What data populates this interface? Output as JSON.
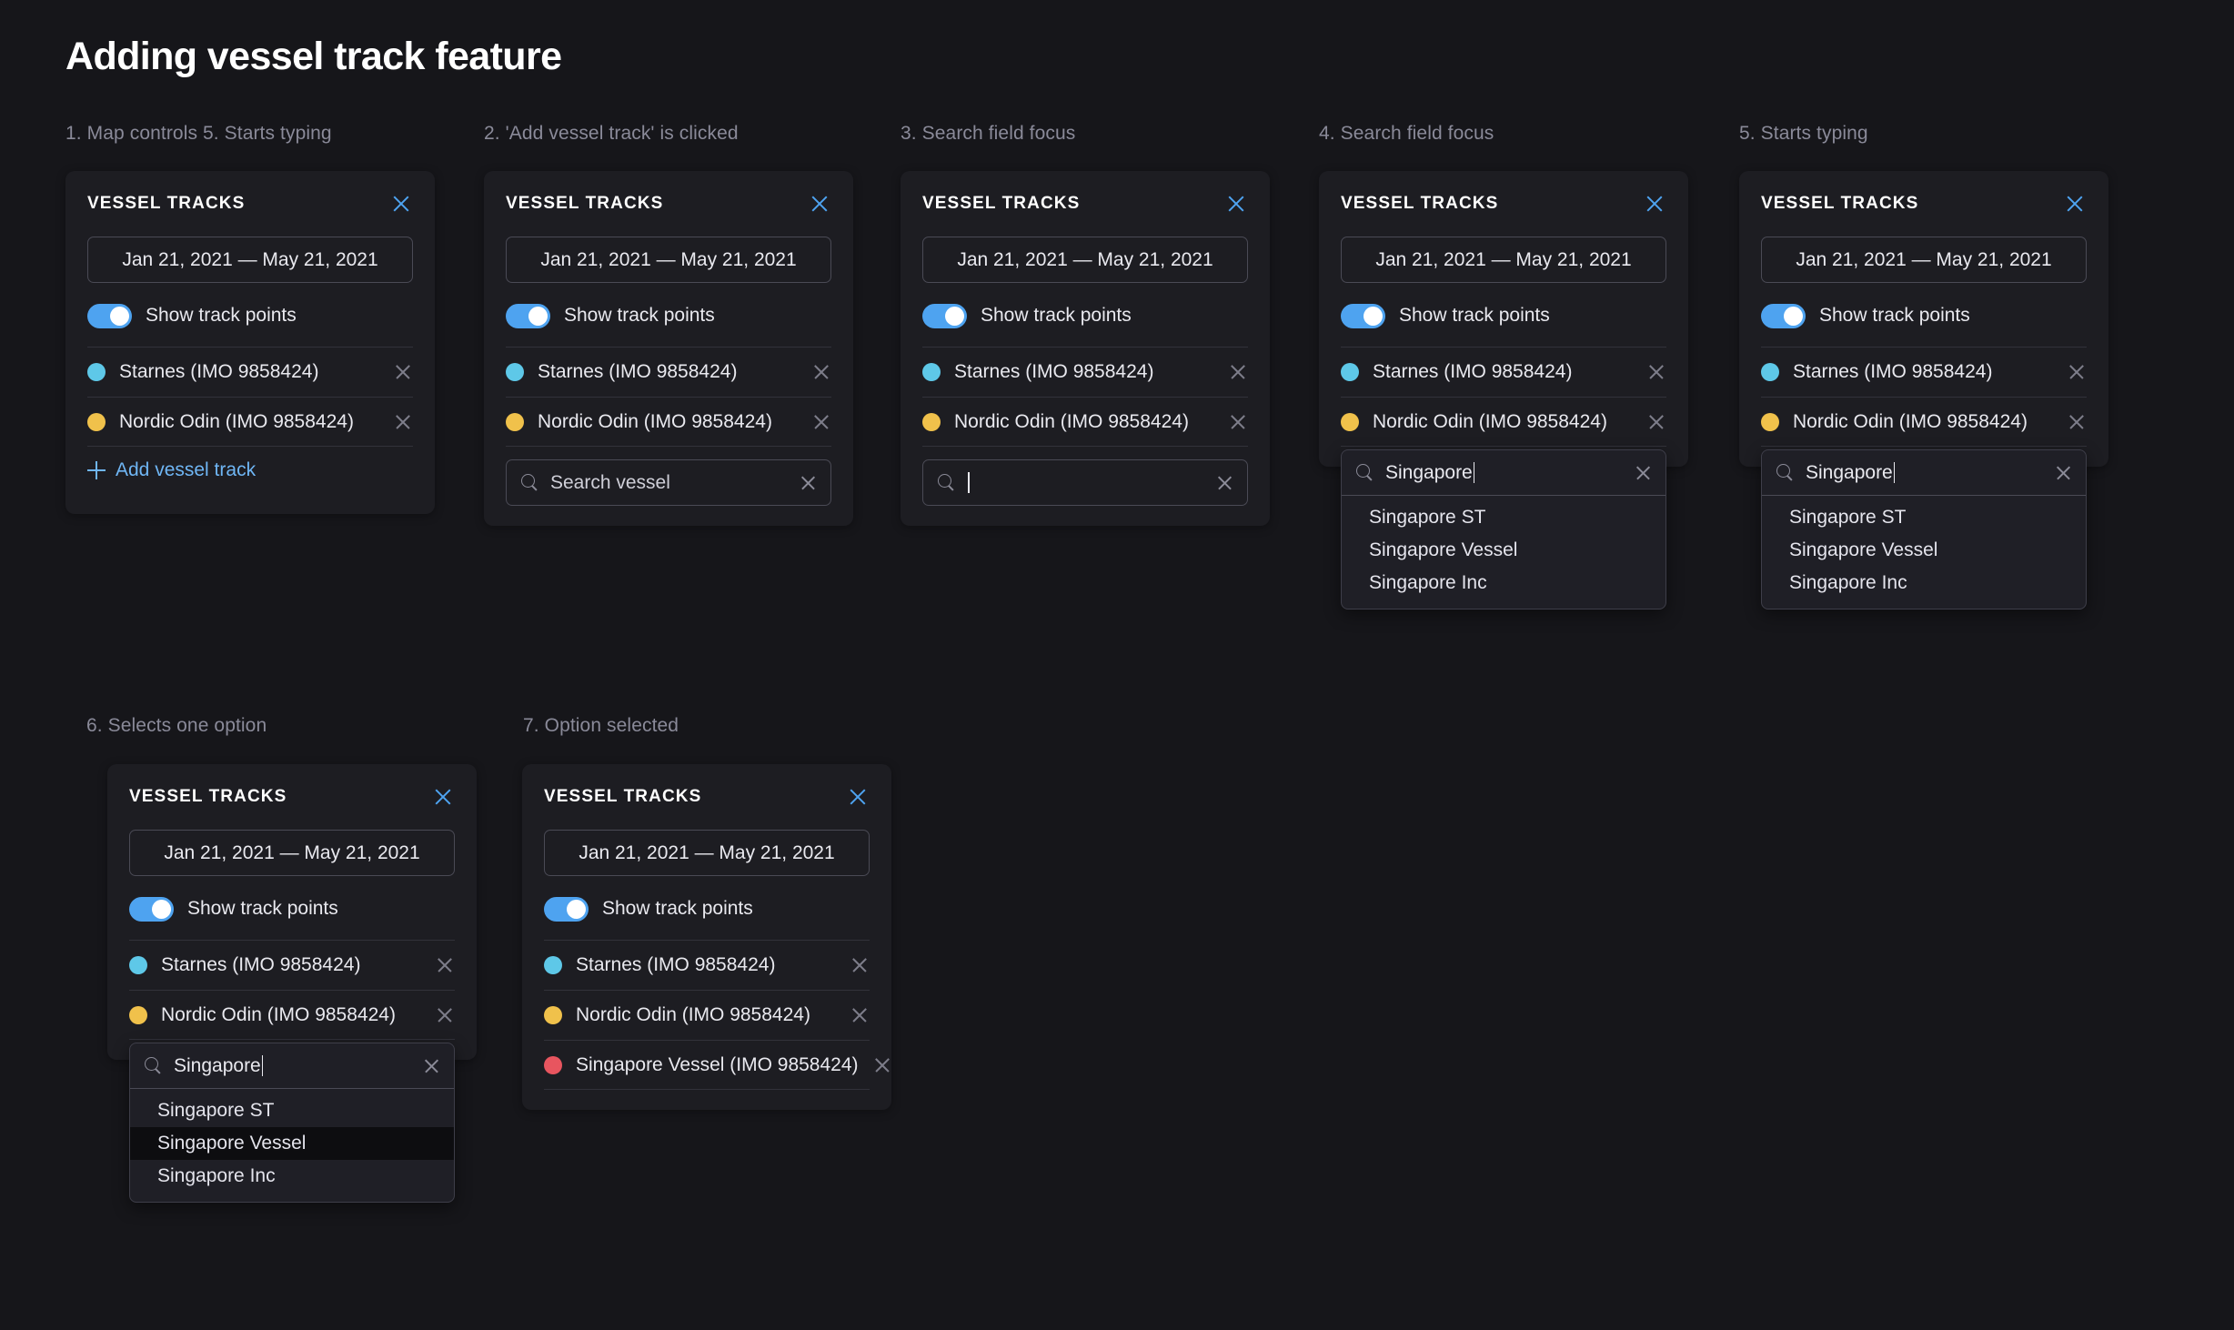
{
  "title": "Adding vessel track feature",
  "common": {
    "card_title": "VESSEL TRACKS",
    "date_range": "Jan 21, 2021 — May 21, 2021",
    "toggle_label": "Show track points",
    "add_link": "Add vessel track",
    "search_placeholder": "Search vessel",
    "search_query": "Singapore",
    "vessels": {
      "starnes": {
        "name": "Starnes (IMO 9858424)",
        "color": "#5ec8e8"
      },
      "nordic": {
        "name": "Nordic Odin (IMO 9858424)",
        "color": "#f0c14b"
      },
      "singapore": {
        "name": "Singapore Vessel (IMO 9858424)",
        "color": "#e8555f"
      }
    },
    "suggestions": [
      "Singapore ST",
      "Singapore Vessel",
      "Singapore Inc"
    ],
    "hovered_suggestion": "Singapore Vessel"
  },
  "steps": [
    {
      "label": "1. Map controls  5. Starts typing"
    },
    {
      "label": "2. 'Add vessel track' is clicked"
    },
    {
      "label": "3. Search field focus"
    },
    {
      "label": "4. Search field focus"
    },
    {
      "label": "5. Starts typing"
    },
    {
      "label": "6. Selects one option"
    },
    {
      "label": "7. Option selected"
    }
  ],
  "colors": {
    "accent_blue": "#4ea3f0",
    "link_blue": "#6fb6f5",
    "card_bg": "#1d1d22",
    "page_bg": "#16161a"
  }
}
